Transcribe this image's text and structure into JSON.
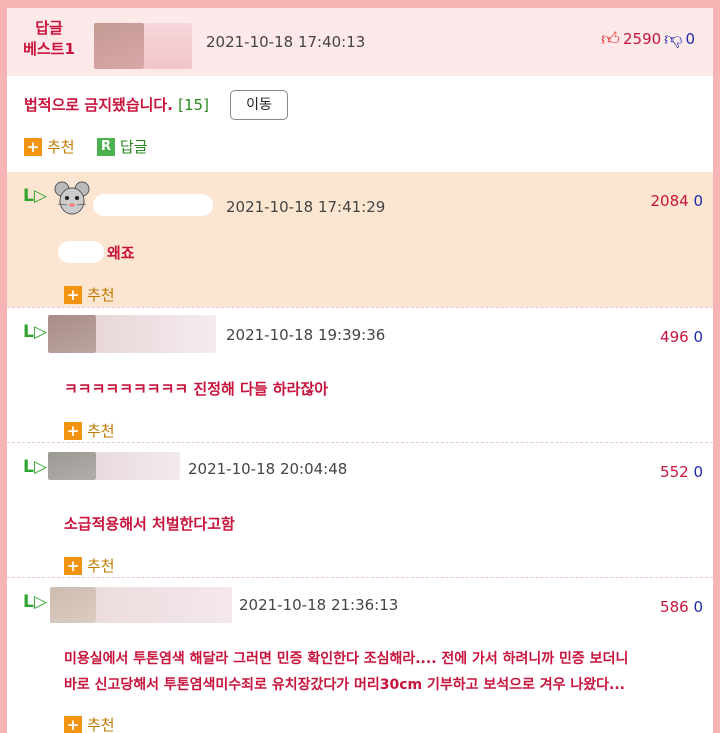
{
  "best": {
    "label_line1": "답글",
    "label_line2": "베스트1",
    "date": "2021-10-18 17:40:13",
    "up": "2590",
    "down": "0"
  },
  "post": {
    "title": "법적으로 금지됐습니다.",
    "count": "[15]",
    "move_label": "이동",
    "recommend_label": "추천",
    "reply_label": "답글"
  },
  "replies": [
    {
      "date": "2021-10-18 17:41:29",
      "up": "2084",
      "down": "0",
      "text": "왜죠",
      "recommend": "추천"
    },
    {
      "date": "2021-10-18 19:39:36",
      "up": "496",
      "down": "0",
      "text": "ㅋㅋㅋㅋㅋㅋㅋㅋㅋ 진정해 다들 하라잖아",
      "recommend": "추천"
    },
    {
      "date": "2021-10-18 20:04:48",
      "up": "552",
      "down": "0",
      "text": "소급적용해서 처벌한다고함",
      "recommend": "추천"
    },
    {
      "date": "2021-10-18 21:36:13",
      "up": "586",
      "down": "0",
      "text_line1": "미용실에서 투톤염색 해달라 그러면 민증 확인한다 조심해라.... 전에 가서 하려니까 민증 보더니",
      "text_line2": "바로 신고당해서 투톤염색미수죄로 유치장갔다가 머리30cm 기부하고 보석으로 겨우 나왔다...",
      "recommend": "추천"
    }
  ],
  "colors": {
    "accent_red": "#c8143c",
    "vote_down_blue": "#1e2aa8",
    "reply_green": "#2fa52f",
    "recommend_orange": "#f29411",
    "highlight_bg": "#fce6d2"
  },
  "icons": [
    "thumbs-up-icon",
    "thumbs-down-icon",
    "reply-arrow-icon",
    "plus-icon",
    "r-icon",
    "mouse-avatar-icon"
  ]
}
